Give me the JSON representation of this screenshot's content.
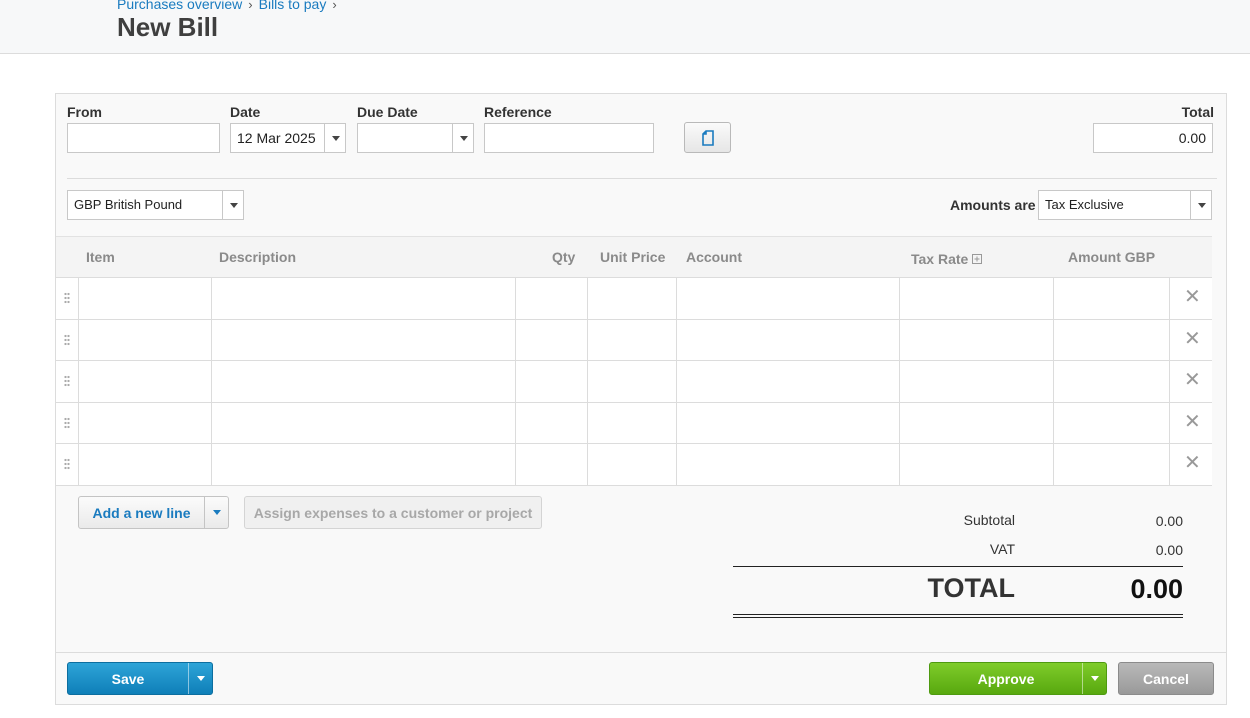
{
  "breadcrumb": {
    "items": [
      "Purchases overview",
      "Bills to pay"
    ],
    "separator": "›"
  },
  "page": {
    "title": "New Bill"
  },
  "form": {
    "from_label": "From",
    "from_value": "",
    "date_label": "Date",
    "date_value": "12 Mar 2025",
    "due_date_label": "Due Date",
    "due_date_value": "",
    "reference_label": "Reference",
    "reference_value": "",
    "total_label": "Total",
    "total_value": "0.00",
    "currency_value": "GBP British Pound",
    "amounts_are_label": "Amounts are",
    "amounts_are_value": "Tax Exclusive"
  },
  "grid": {
    "columns": [
      "Item",
      "Description",
      "Qty",
      "Unit Price",
      "Account",
      "Tax Rate",
      "Amount GBP"
    ],
    "row_count": 5,
    "delete_glyph": "✕"
  },
  "actions": {
    "add_line_label": "Add a new line",
    "assign_label": "Assign expenses to a customer or project"
  },
  "totals": {
    "subtotal_label": "Subtotal",
    "subtotal_value": "0.00",
    "vat_label": "VAT",
    "vat_value": "0.00",
    "total_label": "TOTAL",
    "total_value": "0.00"
  },
  "footer": {
    "save_label": "Save",
    "approve_label": "Approve",
    "cancel_label": "Cancel"
  },
  "colors": {
    "link": "#1a7bbf",
    "save": "#1b8fc8",
    "approve": "#6bbd1c",
    "cancel": "#a6a6a6"
  },
  "icons": {
    "copy": "copy-icon",
    "drag": "drag-handle-icon",
    "delete": "close-icon",
    "dropdown": "chevron-down-icon",
    "plus": "plus-box-icon"
  }
}
